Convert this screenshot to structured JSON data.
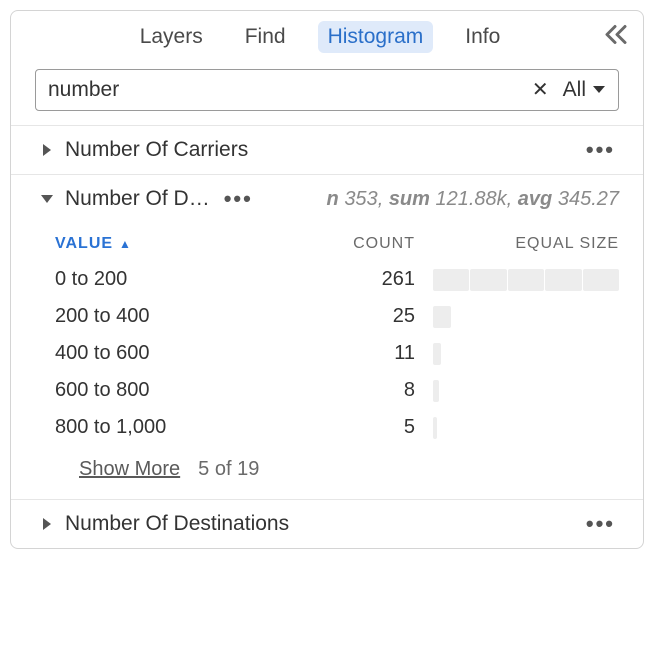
{
  "tabs": {
    "layers": "Layers",
    "find": "Find",
    "histogram": "Histogram",
    "info": "Info"
  },
  "search": {
    "value": "number",
    "filter_label": "All"
  },
  "sections": {
    "carriers": {
      "title": "Number Of Carriers"
    },
    "d": {
      "title": "Number Of D…",
      "stats": {
        "n_label": "n",
        "n_val": "353",
        "sum_label": "sum",
        "sum_val": "121.88k",
        "avg_label": "avg",
        "avg_val": "345.27"
      },
      "headers": {
        "value": "VALUE",
        "count": "COUNT",
        "equal": "EQUAL SIZE"
      },
      "rows": [
        {
          "value": "0 to 200",
          "count": "261",
          "pct": 100
        },
        {
          "value": "200 to 400",
          "count": "25",
          "pct": 9.6
        },
        {
          "value": "400 to 600",
          "count": "11",
          "pct": 4.2
        },
        {
          "value": "600 to 800",
          "count": "8",
          "pct": 3.1
        },
        {
          "value": "800 to 1,000",
          "count": "5",
          "pct": 1.9
        }
      ],
      "show_more": "Show More",
      "page_info": "5 of 19"
    },
    "destinations": {
      "title": "Number Of Destinations"
    }
  }
}
